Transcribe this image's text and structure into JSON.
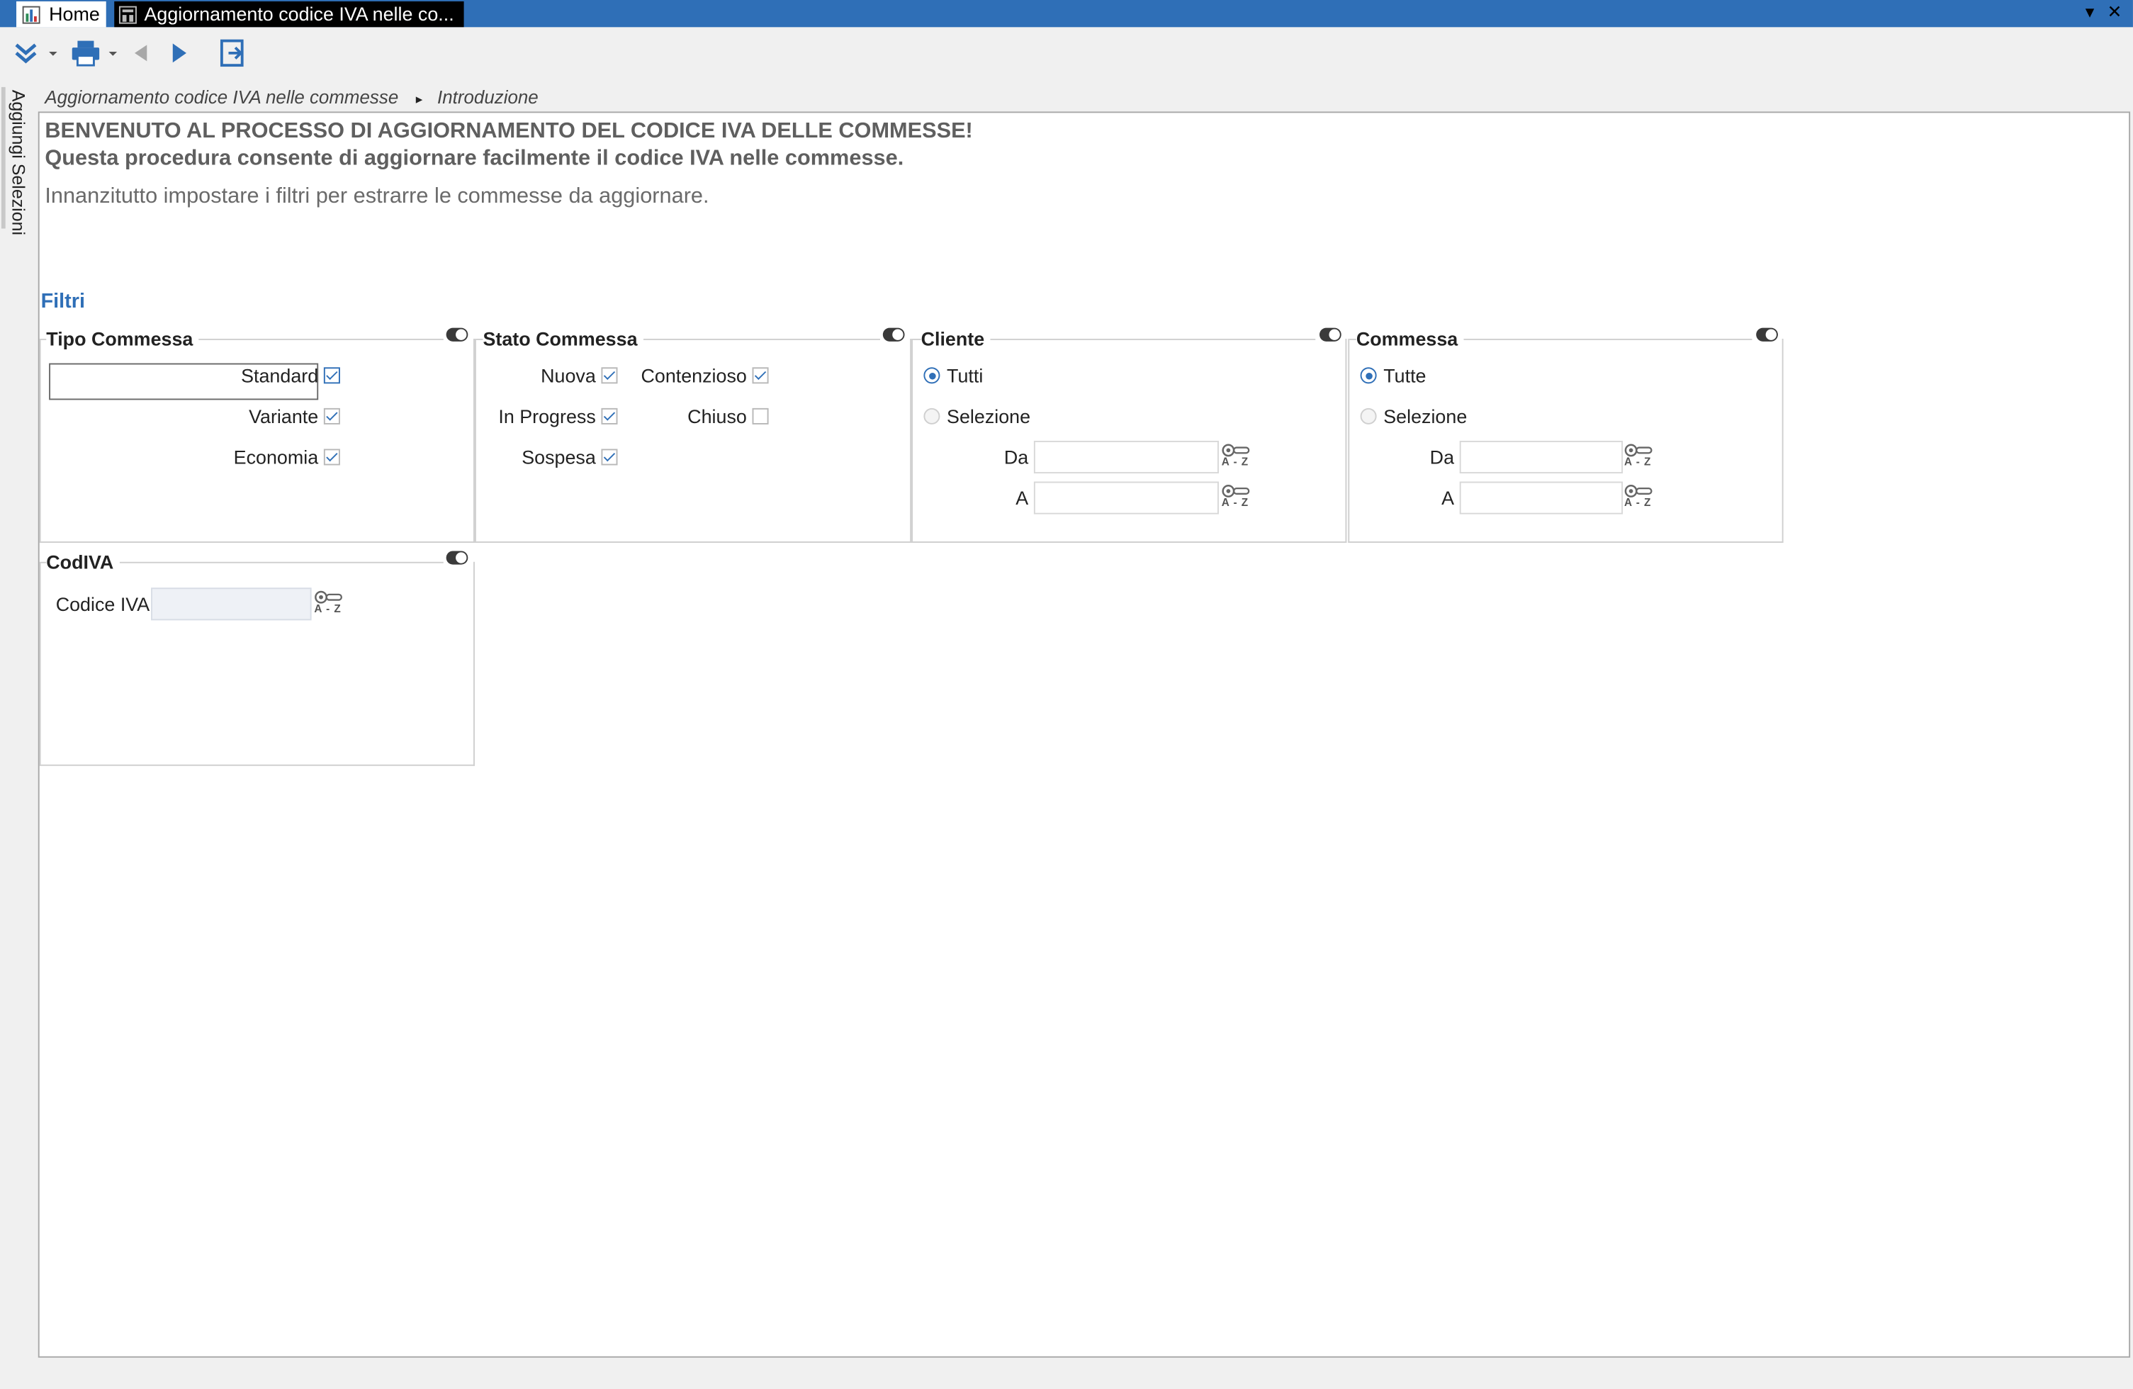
{
  "window": {
    "home_tab": "Home",
    "active_tab": "Aggiornamento codice IVA nelle co...",
    "controls": {
      "dropdown": "▾",
      "close": "✕"
    }
  },
  "toolbar": {
    "buttons": [
      {
        "name": "expand",
        "icon": "double-chevron-down-icon"
      },
      {
        "name": "print",
        "icon": "printer-icon"
      },
      {
        "name": "back",
        "icon": "arrow-left-icon"
      },
      {
        "name": "forward",
        "icon": "arrow-right-icon"
      },
      {
        "name": "exit",
        "icon": "exit-icon"
      }
    ]
  },
  "side_panel": {
    "label": "Aggiungi Selezioni"
  },
  "breadcrumb": {
    "root": "Aggiornamento codice IVA nelle commesse",
    "separator": "▸",
    "current": "Introduzione"
  },
  "content": {
    "welcome": "BENVENUTO AL PROCESSO DI AGGIORNAMENTO DEL CODICE IVA DELLE COMMESSE!",
    "subtitle": "Questa procedura consente di aggiornare facilmente il codice IVA nelle commesse.",
    "intro": "Innanzitutto impostare i filtri per estrarre le commesse da aggiornare.",
    "filters_title": "Filtri"
  },
  "groups": {
    "tipo_commessa": {
      "title": "Tipo Commessa",
      "options": [
        {
          "label": "Standard",
          "checked": true
        },
        {
          "label": "Variante",
          "checked": true
        },
        {
          "label": "Economia",
          "checked": true
        }
      ]
    },
    "stato_commessa": {
      "title": "Stato Commessa",
      "options": [
        {
          "label": "Nuova",
          "checked": true
        },
        {
          "label": "Contenzioso",
          "checked": true
        },
        {
          "label": "In Progress",
          "checked": true
        },
        {
          "label": "Chiuso",
          "checked": false
        },
        {
          "label": "Sospesa",
          "checked": true
        }
      ]
    },
    "cliente": {
      "title": "Cliente",
      "radio_all": "Tutti",
      "radio_select": "Selezione",
      "selected": "Tutti",
      "from_label": "Da",
      "to_label": "A",
      "from_value": "",
      "to_value": ""
    },
    "commessa": {
      "title": "Commessa",
      "radio_all": "Tutte",
      "radio_select": "Selezione",
      "selected": "Tutte",
      "from_label": "Da",
      "to_label": "A",
      "from_value": "",
      "to_value": ""
    },
    "codiva": {
      "title": "CodIVA",
      "field_label": "Codice IVA",
      "field_value": ""
    }
  },
  "lookup": {
    "az_label": "A - Z",
    "icon": "key-lookup-icon"
  },
  "colors": {
    "titlebar": "#2f6fb7",
    "accent": "#2f6fb7",
    "text_muted": "#5f5f5f"
  }
}
